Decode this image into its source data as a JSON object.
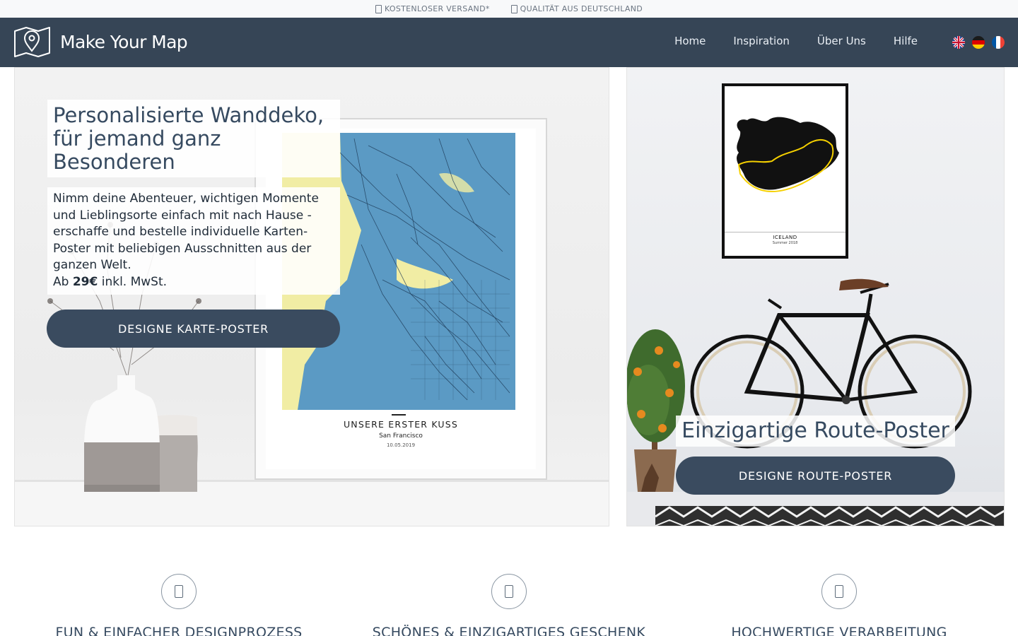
{
  "topbar": {
    "items": [
      {
        "icon": "shipping-icon",
        "label": "KOSTENLOSER VERSAND*"
      },
      {
        "icon": "quality-icon",
        "label": "QUALITÄT AUS DEUTSCHLAND"
      }
    ]
  },
  "header": {
    "brand": "Make Your Map",
    "logo_icon": "map-pin-logo-icon",
    "nav": [
      "Home",
      "Inspiration",
      "Über Uns",
      "Hilfe"
    ],
    "languages": [
      {
        "code": "en",
        "icon": "uk-flag-icon"
      },
      {
        "code": "de",
        "icon": "germany-flag-icon"
      },
      {
        "code": "fr",
        "icon": "france-flag-icon"
      }
    ],
    "background": "#364556"
  },
  "hero_left": {
    "headline": "Personalisierte Wanddeko, für jemand ganz Besonderen",
    "description": "Nimm deine Abenteuer, wichtigen Momente und Lieblingsorte einfach mit nach Hause - erschaffe und bestelle individuelle Karten-Poster mit beliebigen Ausschnitten aus der ganzen Welt.",
    "price_prefix": "Ab ",
    "price": "29€",
    "price_suffix": " inkl. MwSt.",
    "cta": "DESIGNE KARTE-POSTER",
    "poster": {
      "title": "UNSERE ERSTER KUSS",
      "subtitle": "San Francisco",
      "date": "10.05.2019"
    }
  },
  "hero_right": {
    "title": "Einzigartige Route-Poster",
    "cta": "DESIGNE ROUTE-POSTER",
    "poster": {
      "title": "ICELAND",
      "subtitle": "Summer 2018"
    }
  },
  "features": [
    {
      "icon": "feature-icon",
      "title": "FUN & EINFACHER DESIGNPROZESS"
    },
    {
      "icon": "feature-icon",
      "title": "SCHÖNES & EINZIGARTIGES GESCHENK"
    },
    {
      "icon": "feature-icon",
      "title": "HOCHWERTIGE VERARBEITUNG"
    }
  ],
  "colors": {
    "accent": "#3a4b5f",
    "text": "#364a60",
    "map_water": "#5b9ac4",
    "map_land": "#f1eda4"
  }
}
